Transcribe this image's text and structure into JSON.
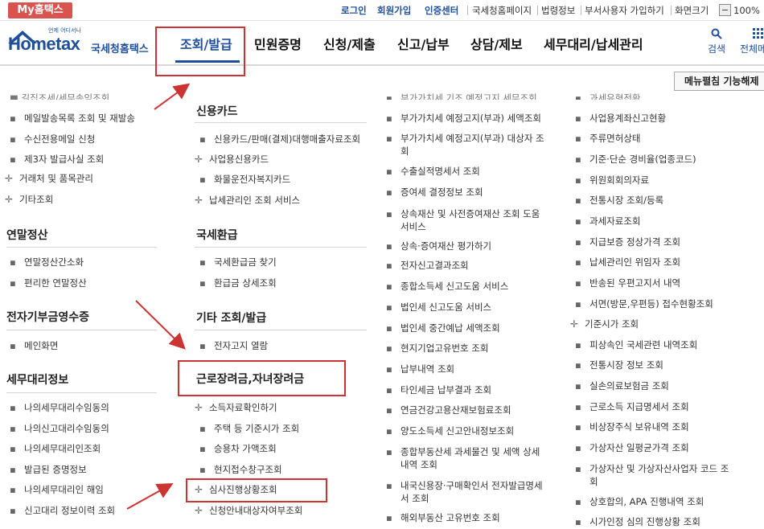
{
  "topbar": {
    "myhome": "My홈택스",
    "login": "로그인",
    "signup": "회원가입",
    "cert": "인증센터",
    "links": [
      "국세청홈페이지",
      "법령정보",
      "부서사용자 가입하기",
      "화면크기"
    ],
    "zoom_minus": "−",
    "zoom_value": "100%"
  },
  "header": {
    "logo_text": "Hometax",
    "logo_small": "언제 어디서나",
    "logo_brand": "국세청홈택스",
    "nav": [
      "조회/발급",
      "민원증명",
      "신청/제출",
      "신고/납부",
      "상담/제보",
      "세무대리/납세관리"
    ],
    "search": "검색",
    "all_menu": "전체메"
  },
  "menu_button": "메뉴펼침 기능해제",
  "col1": {
    "top_partial": "■ 길집조세/세무속익조회",
    "items": [
      "메일발송목록 조회 및 재발송",
      "수신전용메일 신청",
      "제3자 발급사실 조회"
    ],
    "plus_items": [
      "거래처 및 품목관리",
      "기타조회"
    ],
    "sec_yearend": "연말정산",
    "yearend_items": [
      "연말정산간소화",
      "편리한 연말정산"
    ],
    "sec_donation": "전자기부금영수증",
    "donation_items": [
      "메인화면"
    ],
    "sec_taxagent": "세무대리정보",
    "taxagent_items": [
      "나의세무대리수임동의",
      "나의신고대리수임동의",
      "나의세무대리인조회",
      "발급된 증명정보",
      "나의세무대리인 해임",
      "신고대리 정보이력 조회"
    ]
  },
  "col2": {
    "sec_card": "신용카드",
    "card_items": [
      "신용카드/판매(결제)대행매출자료조회"
    ],
    "card_plus": [
      "사업용신용카드"
    ],
    "card_items2": [
      "화물운전자복지카드"
    ],
    "card_plus2": [
      "납세관리인 조회 서비스"
    ],
    "sec_refund": "국세환급",
    "refund_items": [
      "국세환급금 찾기",
      "환급금 상세조회"
    ],
    "sec_etc": "기타 조회/발급",
    "etc_items": [
      "전자고지 열람"
    ],
    "sec_eitc": "근로장려금,자녀장려금",
    "eitc_plus": [
      "소득자료확인하기"
    ],
    "eitc_items": [
      "주택 등 기준시가 조회",
      "승용차 가액조회",
      "현지접수창구조회"
    ],
    "eitc_plus2": [
      "심사진행상황조회",
      "신청안내대상자여부조회"
    ]
  },
  "col3": {
    "top_partial": "부가가치세 기조 예정고지 세무조회",
    "items": [
      "부가가치세 예정고지(부과) 세액조회",
      "부가가치세 예정고지(부과) 대상자 조회",
      "수출실적명세서 조회",
      "증여세 결정정보 조회",
      "상속재산 및 사전증여재산 조회 도움 서비스",
      "상속·증여재산 평가하기",
      "전자신고결과조회",
      "종합소득세 신고도움 서비스",
      "법인세 신고도움 서비스",
      "법인세 중간예납 세액조회",
      "현지기업고유번호 조회",
      "납부내역 조회",
      "타인세금 납부결과 조회",
      "연금건강고용산재보험료조회",
      "양도소득세 신고안내정보조회",
      "종합부동산세 과세물건 및 세액 상세 내역 조회",
      "내국신용장·구매확인서 전자발급명세서 조회",
      "해외부동산 고유번호 조회"
    ]
  },
  "col4": {
    "top_partial": "과세유형전환",
    "items": [
      "사업용계좌신고현황",
      "주류면허상태",
      "기준·단순 경비율(업종코드)",
      "위원회회의자료",
      "전통시장 조회/등록",
      "과세자료조회",
      "지급보증 정상가격 조회",
      "납세관리인 위임자 조회",
      "반송된 우편고지서 내역",
      "서면(방문,우편등) 접수현황조회"
    ],
    "plus_item": "기준시가 조회",
    "items2": [
      "피상속인 국세관련 내역조회",
      "전통시장 정보 조회",
      "실손의료보험금 조회",
      "근로소득 지급명세서 조회",
      "비상장주식 보유내역 조회",
      "가상자산 일평균가격 조회",
      "가상자산 및 가상자산사업자 코드 조회",
      "상호합의, APA 진행내역 조회",
      "시가인정 심의 진행상황 조회"
    ]
  },
  "colors": {
    "accent": "#1f4f9a",
    "highlight": "#cc3333",
    "myhome_bg": "#d9534f"
  }
}
